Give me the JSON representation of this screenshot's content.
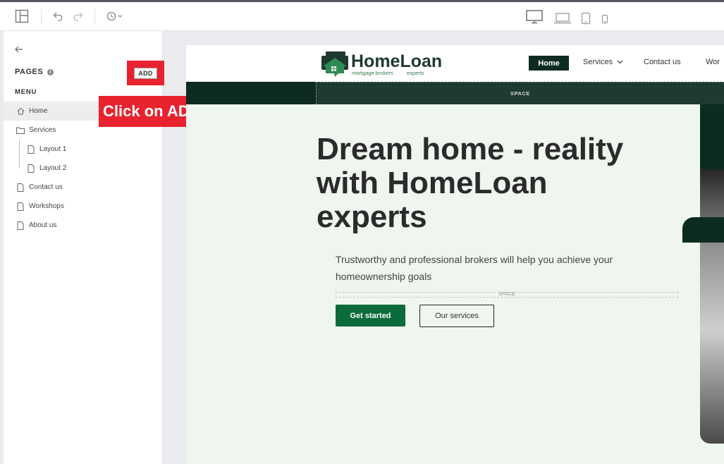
{
  "toolbar": {
    "icons": [
      "layout-icon",
      "undo-icon",
      "redo-icon",
      "history-icon",
      "desktop-icon",
      "laptop-icon",
      "tablet-icon",
      "mobile-icon"
    ]
  },
  "sidebar": {
    "pages_label": "PAGES",
    "add_label": "ADD",
    "menu_label": "MENU",
    "items": [
      {
        "label": "Home",
        "icon": "home-icon"
      },
      {
        "label": "Services",
        "icon": "folder-icon"
      },
      {
        "label": "Layout 1",
        "icon": "page-icon"
      },
      {
        "label": "Layout 2",
        "icon": "page-icon"
      },
      {
        "label": "Contact us",
        "icon": "page-icon"
      },
      {
        "label": "Workshops",
        "icon": "page-icon"
      },
      {
        "label": "About us",
        "icon": "page-icon"
      }
    ]
  },
  "callout": {
    "text": "Click on ADD",
    "color": "#e8222e"
  },
  "site": {
    "logo": {
      "name": "HomeLoan",
      "tagline_left": "mortgage brokers",
      "tagline_right": "experts"
    },
    "nav": {
      "home": "Home",
      "services": "Services",
      "contact": "Contact us",
      "workshops": "Wor"
    },
    "space_label": "SPACE",
    "hero": {
      "title_line1": "Dream home - reality",
      "title_line2": "with HomeLoan",
      "title_line3": "experts",
      "subtitle_line1": "Trustworthy and professional brokers will help you achieve your",
      "subtitle_line2": "homeownership goals",
      "space_label": "SPACE",
      "primary_button": "Get started",
      "secondary_button": "Our services"
    },
    "colors": {
      "brand_dark": "#0e2b20",
      "brand_green": "#0c6b3b",
      "hero_bg": "#eff5ef"
    }
  }
}
